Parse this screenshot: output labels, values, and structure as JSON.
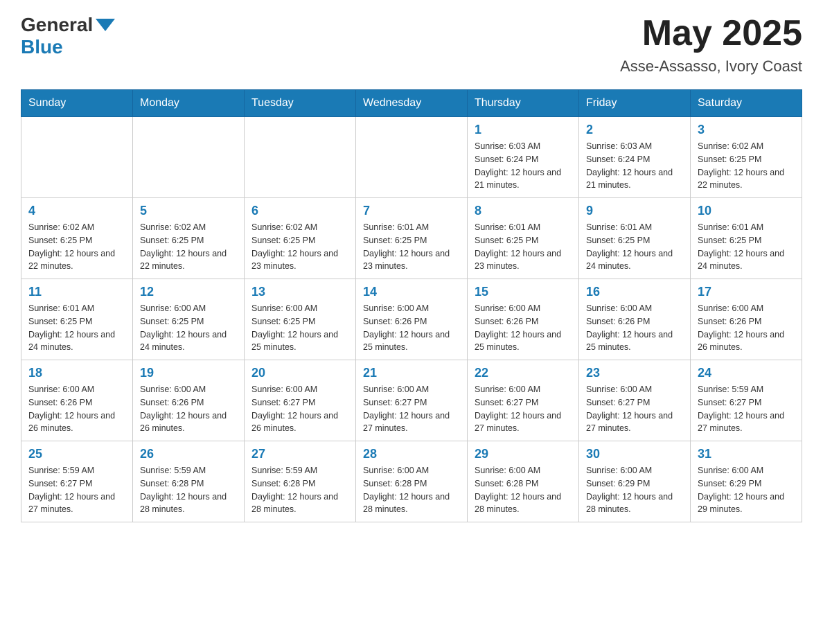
{
  "header": {
    "logo_text": "General",
    "logo_blue": "Blue",
    "month_title": "May 2025",
    "location": "Asse-Assasso, Ivory Coast"
  },
  "days_of_week": [
    "Sunday",
    "Monday",
    "Tuesday",
    "Wednesday",
    "Thursday",
    "Friday",
    "Saturday"
  ],
  "weeks": [
    [
      {
        "day": "",
        "info": ""
      },
      {
        "day": "",
        "info": ""
      },
      {
        "day": "",
        "info": ""
      },
      {
        "day": "",
        "info": ""
      },
      {
        "day": "1",
        "info": "Sunrise: 6:03 AM\nSunset: 6:24 PM\nDaylight: 12 hours and 21 minutes."
      },
      {
        "day": "2",
        "info": "Sunrise: 6:03 AM\nSunset: 6:24 PM\nDaylight: 12 hours and 21 minutes."
      },
      {
        "day": "3",
        "info": "Sunrise: 6:02 AM\nSunset: 6:25 PM\nDaylight: 12 hours and 22 minutes."
      }
    ],
    [
      {
        "day": "4",
        "info": "Sunrise: 6:02 AM\nSunset: 6:25 PM\nDaylight: 12 hours and 22 minutes."
      },
      {
        "day": "5",
        "info": "Sunrise: 6:02 AM\nSunset: 6:25 PM\nDaylight: 12 hours and 22 minutes."
      },
      {
        "day": "6",
        "info": "Sunrise: 6:02 AM\nSunset: 6:25 PM\nDaylight: 12 hours and 23 minutes."
      },
      {
        "day": "7",
        "info": "Sunrise: 6:01 AM\nSunset: 6:25 PM\nDaylight: 12 hours and 23 minutes."
      },
      {
        "day": "8",
        "info": "Sunrise: 6:01 AM\nSunset: 6:25 PM\nDaylight: 12 hours and 23 minutes."
      },
      {
        "day": "9",
        "info": "Sunrise: 6:01 AM\nSunset: 6:25 PM\nDaylight: 12 hours and 24 minutes."
      },
      {
        "day": "10",
        "info": "Sunrise: 6:01 AM\nSunset: 6:25 PM\nDaylight: 12 hours and 24 minutes."
      }
    ],
    [
      {
        "day": "11",
        "info": "Sunrise: 6:01 AM\nSunset: 6:25 PM\nDaylight: 12 hours and 24 minutes."
      },
      {
        "day": "12",
        "info": "Sunrise: 6:00 AM\nSunset: 6:25 PM\nDaylight: 12 hours and 24 minutes."
      },
      {
        "day": "13",
        "info": "Sunrise: 6:00 AM\nSunset: 6:25 PM\nDaylight: 12 hours and 25 minutes."
      },
      {
        "day": "14",
        "info": "Sunrise: 6:00 AM\nSunset: 6:26 PM\nDaylight: 12 hours and 25 minutes."
      },
      {
        "day": "15",
        "info": "Sunrise: 6:00 AM\nSunset: 6:26 PM\nDaylight: 12 hours and 25 minutes."
      },
      {
        "day": "16",
        "info": "Sunrise: 6:00 AM\nSunset: 6:26 PM\nDaylight: 12 hours and 25 minutes."
      },
      {
        "day": "17",
        "info": "Sunrise: 6:00 AM\nSunset: 6:26 PM\nDaylight: 12 hours and 26 minutes."
      }
    ],
    [
      {
        "day": "18",
        "info": "Sunrise: 6:00 AM\nSunset: 6:26 PM\nDaylight: 12 hours and 26 minutes."
      },
      {
        "day": "19",
        "info": "Sunrise: 6:00 AM\nSunset: 6:26 PM\nDaylight: 12 hours and 26 minutes."
      },
      {
        "day": "20",
        "info": "Sunrise: 6:00 AM\nSunset: 6:27 PM\nDaylight: 12 hours and 26 minutes."
      },
      {
        "day": "21",
        "info": "Sunrise: 6:00 AM\nSunset: 6:27 PM\nDaylight: 12 hours and 27 minutes."
      },
      {
        "day": "22",
        "info": "Sunrise: 6:00 AM\nSunset: 6:27 PM\nDaylight: 12 hours and 27 minutes."
      },
      {
        "day": "23",
        "info": "Sunrise: 6:00 AM\nSunset: 6:27 PM\nDaylight: 12 hours and 27 minutes."
      },
      {
        "day": "24",
        "info": "Sunrise: 5:59 AM\nSunset: 6:27 PM\nDaylight: 12 hours and 27 minutes."
      }
    ],
    [
      {
        "day": "25",
        "info": "Sunrise: 5:59 AM\nSunset: 6:27 PM\nDaylight: 12 hours and 27 minutes."
      },
      {
        "day": "26",
        "info": "Sunrise: 5:59 AM\nSunset: 6:28 PM\nDaylight: 12 hours and 28 minutes."
      },
      {
        "day": "27",
        "info": "Sunrise: 5:59 AM\nSunset: 6:28 PM\nDaylight: 12 hours and 28 minutes."
      },
      {
        "day": "28",
        "info": "Sunrise: 6:00 AM\nSunset: 6:28 PM\nDaylight: 12 hours and 28 minutes."
      },
      {
        "day": "29",
        "info": "Sunrise: 6:00 AM\nSunset: 6:28 PM\nDaylight: 12 hours and 28 minutes."
      },
      {
        "day": "30",
        "info": "Sunrise: 6:00 AM\nSunset: 6:29 PM\nDaylight: 12 hours and 28 minutes."
      },
      {
        "day": "31",
        "info": "Sunrise: 6:00 AM\nSunset: 6:29 PM\nDaylight: 12 hours and 29 minutes."
      }
    ]
  ]
}
